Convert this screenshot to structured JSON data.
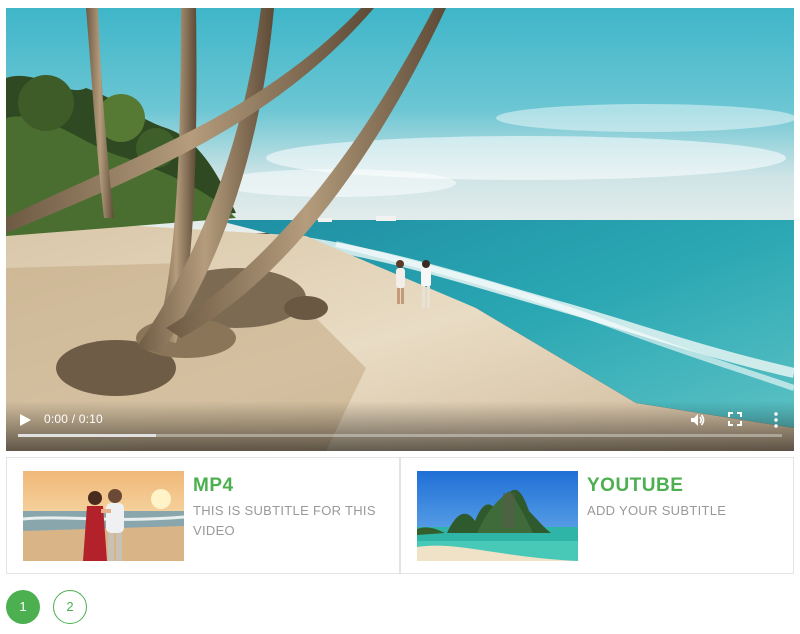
{
  "player": {
    "time_current": "0:00",
    "time_separator": " / ",
    "time_total": "0:10",
    "progress": 0.18,
    "icons": {
      "play": "play-icon",
      "volume": "volume-icon",
      "fullscreen": "fullscreen-icon",
      "more": "more-vertical-icon"
    }
  },
  "playlist": [
    {
      "title": "MP4",
      "subtitle": "THIS IS SUBTITLE FOR THIS VIDEO"
    },
    {
      "title": "YOUTUBE",
      "subtitle": "ADD YOUR SUBTITLE"
    }
  ],
  "pagination": {
    "pages": [
      "1",
      "2"
    ],
    "current": "1"
  },
  "colors": {
    "accent": "#4caf50",
    "subtitle": "#999999",
    "card_border": "#e4e4e4"
  }
}
